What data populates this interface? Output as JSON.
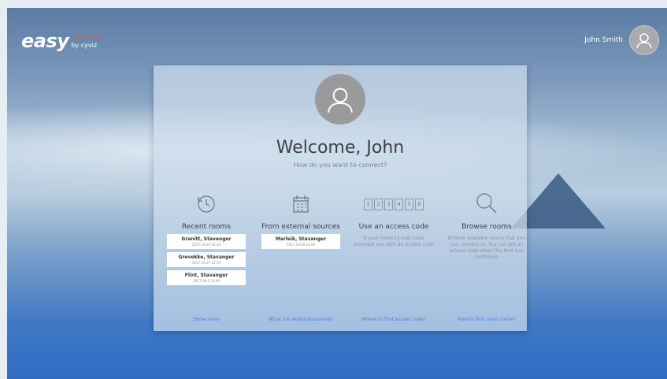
{
  "brand": {
    "main": "easy",
    "connect": "connect",
    "by": "by cyviz"
  },
  "header": {
    "user_name": "John Smith"
  },
  "card": {
    "title": "Welcome, John",
    "subtitle": "How do you want to connect?",
    "options": [
      {
        "title": "Recent rooms",
        "link": "Show more",
        "rooms": [
          {
            "name": "Granitt, Stavanger",
            "date": "2017-10-29 10:19"
          },
          {
            "name": "Grevekke, Stavanger",
            "date": "2017-10-27 12:19"
          },
          {
            "name": "Flint, Stavanger",
            "date": "2017-10-17 8:49"
          }
        ]
      },
      {
        "title": "From external sources",
        "link": "What are external sources?",
        "rooms": [
          {
            "name": "Marleik, Stavanger",
            "date": "2017-10-29 14:00"
          }
        ]
      },
      {
        "title": "Use an access code",
        "link": "Where to find access code?",
        "desc": "If your meeting host have provided you with an access code",
        "code_digits": [
          "1",
          "2",
          "3",
          "4",
          "5",
          "6"
        ]
      },
      {
        "title": "Browse rooms",
        "link": "How to find room name?",
        "desc": "Browse available rooms that you can connect to. You can get an access code when the host has confirmed."
      }
    ]
  },
  "colors": {
    "accent": "#4a86d6",
    "brand_red": "#e8534a"
  },
  "icons": {
    "avatar": "user-silhouette-icon",
    "recent": "history-clock-icon",
    "external": "calendar-icon",
    "code": "access-code-icon",
    "browse": "search-icon"
  }
}
